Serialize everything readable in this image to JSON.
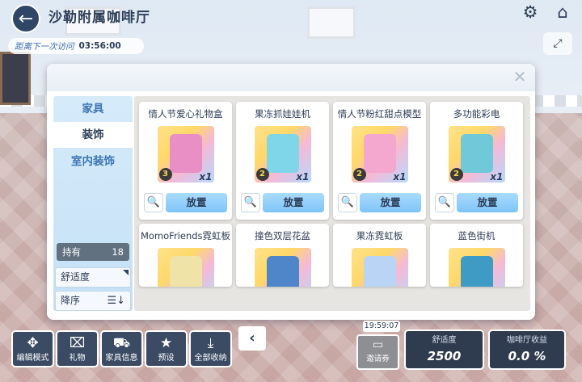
{
  "header": {
    "title": "沙勒附属咖啡厅",
    "last_visit_label": "距离下一次访问",
    "last_visit_time": "03:56:00"
  },
  "icons": {
    "back": "back-arrow-icon",
    "settings": "gear-icon",
    "home": "home-icon",
    "expand": "expand-icon",
    "close": "close-icon"
  },
  "sidebar": {
    "categories": [
      {
        "label": "家具"
      },
      {
        "label": "装饰"
      },
      {
        "label": "室内装饰"
      }
    ],
    "owned_label": "持有",
    "owned_count": "18",
    "filter_label": "舒适度",
    "sort_label": "降序"
  },
  "items_top": [
    {
      "name": "情人节爱心礼物盒",
      "rarity": "3",
      "qty": "x1",
      "find_icon": "magnifier-icon",
      "place_label": "放置",
      "thumb_color": "#e98fc5"
    },
    {
      "name": "果冻抓娃娃机",
      "rarity": "2",
      "qty": "x1",
      "find_icon": "magnifier-icon",
      "place_label": "放置",
      "thumb_color": "#7fd6e8"
    },
    {
      "name": "情人节粉红甜点模型",
      "rarity": "2",
      "qty": "x1",
      "find_icon": "magnifier-icon",
      "place_label": "放置",
      "thumb_color": "#f4a7cf"
    },
    {
      "name": "多功能彩电",
      "rarity": "2",
      "qty": "x1",
      "find_icon": "magnifier-icon",
      "place_label": "放置",
      "thumb_color": "#6fc9d8"
    }
  ],
  "items_bottom": [
    {
      "name": "MomoFriends霓虹板",
      "thumb_color": "#f0e3a8"
    },
    {
      "name": "撞色双层花盆",
      "thumb_color": "#4f86c9"
    },
    {
      "name": "果冻霓虹板",
      "thumb_color": "#b9d4f5"
    },
    {
      "name": "蓝色街机",
      "thumb_color": "#3f9ac4"
    }
  ],
  "bottom_bar": {
    "edit_mode": "编辑模式",
    "gift": "礼物",
    "furniture_info": "家具信息",
    "preset": "预设",
    "collect_all": "全部收纳",
    "clock": "19:59:07",
    "invite": "邀请券",
    "comfort_label": "舒适度",
    "comfort_value": "2500",
    "income_label": "咖啡厅收益",
    "income_value": "0.0 %"
  },
  "colors": {
    "accent_blue": "#7ec4f7",
    "dark_navy": "#2f3c4f",
    "sidebar_bg": "#d6ebfa"
  }
}
